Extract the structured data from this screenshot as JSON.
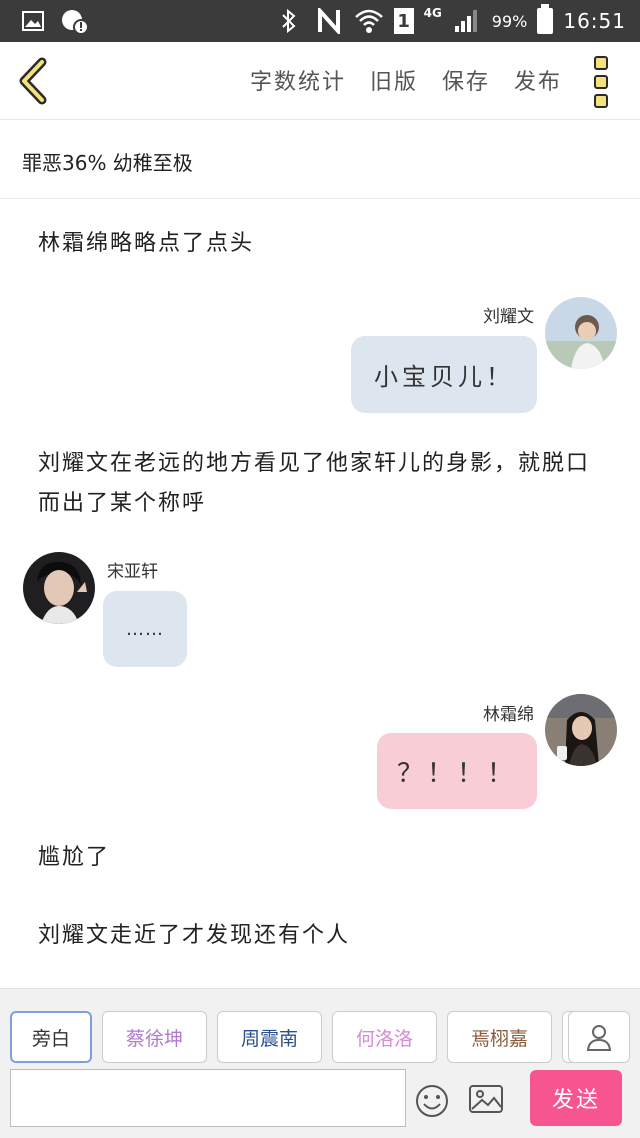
{
  "status_bar": {
    "network": "4G",
    "sim_slot": "1",
    "battery": "99%",
    "time": "16:51",
    "icons": [
      "image-icon",
      "notification-warning-icon",
      "bluetooth-icon",
      "nfc-icon",
      "wifi-icon",
      "signal-icon",
      "battery-icon"
    ]
  },
  "header": {
    "actions": [
      "字数统计",
      "旧版",
      "保存",
      "发布"
    ]
  },
  "subtitle": "罪恶36% 幼稚至极",
  "messages": {
    "narr1": "林霜绵略略点了点头",
    "m1": {
      "name": "刘耀文",
      "text": "小宝贝儿！"
    },
    "narr2": "刘耀文在老远的地方看见了他家轩儿的身影，就脱口而出了某个称呼",
    "m2": {
      "name": "宋亚轩",
      "text": "……"
    },
    "m3": {
      "name": "林霜绵",
      "text": "？！！！"
    },
    "narr3": "尴尬了",
    "narr4": "刘耀文走近了才发现还有个人"
  },
  "bottom": {
    "characters": [
      "旁白",
      "蔡徐坤",
      "周震南",
      "何洛洛",
      "焉栩嘉"
    ],
    "character_colors": [
      "#333333",
      "#b07ad0",
      "#2a4f8f",
      "#d78ad8",
      "#8a5a3a"
    ],
    "send_label": "发送",
    "input_placeholder": ""
  },
  "colors": {
    "accent": "#f6558f",
    "bubble_blue": "#dde5ef",
    "bubble_pink": "#f9cdd5",
    "menu_yellow": "#f3e37a"
  }
}
